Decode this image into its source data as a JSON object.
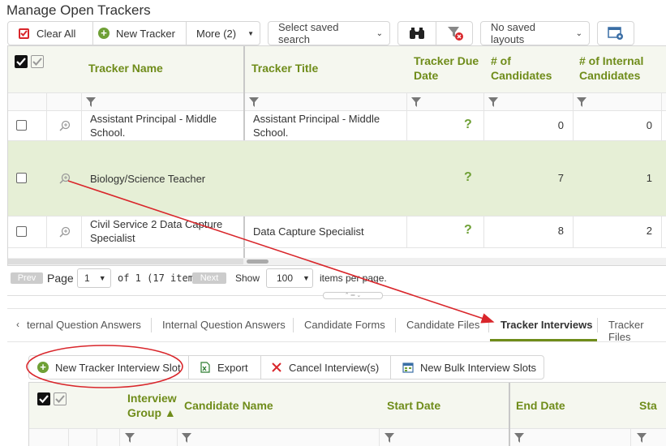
{
  "page": {
    "title": "Manage Open Trackers"
  },
  "toolbar": {
    "clear_all": "Clear All",
    "new_tracker": "New Tracker",
    "more": "More (2)",
    "saved_search_placeholder": "Select saved search",
    "no_saved_layouts": "No saved layouts"
  },
  "grid": {
    "columns": [
      "Tracker Name",
      "Tracker Title",
      "Tracker Due Date",
      "# of Candidates",
      "# of Internal Candidates"
    ],
    "rows": [
      {
        "name": "Assistant Principal - Middle School.",
        "title": "Assistant Principal - Middle School.",
        "due": "?",
        "candidates": "0",
        "internal": "0"
      },
      {
        "name": "Biology/Science Teacher",
        "title": "",
        "due": "?",
        "candidates": "7",
        "internal": "1"
      },
      {
        "name": "Civil Service 2 Data Capture Specialist",
        "title": "Data Capture Specialist",
        "due": "?",
        "candidates": "8",
        "internal": "2"
      }
    ]
  },
  "pager": {
    "prev": "Prev",
    "page_label": "Page",
    "page_value": "1",
    "of_items": "of 1 (17 items)",
    "next": "Next",
    "show": "Show",
    "per_page_value": "100",
    "items_per_page": "items per page."
  },
  "tabs": [
    "ternal Question Answers",
    "Internal Question Answers",
    "Candidate Forms",
    "Candidate Files",
    "Tracker Interviews",
    "Tracker Files"
  ],
  "active_tab": "Tracker Interviews",
  "sub_toolbar": {
    "new_slot": "New Tracker Interview Slot",
    "export": "Export",
    "cancel": "Cancel Interview(s)",
    "bulk": "New Bulk Interview Slots"
  },
  "sub_grid": {
    "columns": [
      "Interview Group ▲",
      "Candidate Name",
      "Start Date",
      "End Date",
      "Sta"
    ]
  },
  "colors": {
    "accent": "#6f8c1a",
    "annotation": "#d9262b",
    "row_highlight": "#e6efd6"
  }
}
